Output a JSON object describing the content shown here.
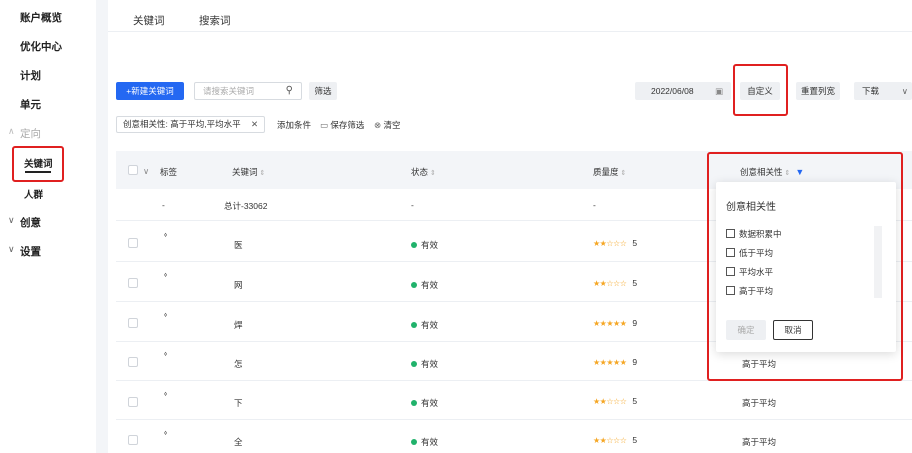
{
  "sidebar": {
    "items": [
      {
        "label": "账户概览"
      },
      {
        "label": "优化中心"
      },
      {
        "label": "计划"
      },
      {
        "label": "单元"
      },
      {
        "label": "定向"
      },
      {
        "label": "关键词"
      },
      {
        "label": "人群"
      },
      {
        "label": "创意"
      },
      {
        "label": "设置"
      }
    ]
  },
  "tabs": [
    {
      "label": "关键词"
    },
    {
      "label": "搜索词"
    }
  ],
  "toolbar": {
    "new_keyword": "+新建关键词",
    "search_placeholder": "请搜索关键词",
    "filter": "筛选",
    "date": "2022/06/08",
    "custom": "自定义",
    "reset_columns": "重置列宽",
    "download": "下载"
  },
  "filter_bar": {
    "chip": "创意相关性: 高于平均,平均水平",
    "add_condition": "添加条件",
    "save_filter": "保存筛选",
    "clear": "清空"
  },
  "table": {
    "columns": [
      "标签",
      "关键词",
      "状态",
      "质量度",
      "创意相关性"
    ],
    "total_row": {
      "tag": "-",
      "keyword": "总计-33062",
      "status": "-",
      "quality": "-"
    },
    "rows": [
      {
        "keyword": "医",
        "status": "有效",
        "stars": "★★☆☆☆",
        "quality": "5",
        "relevance": ""
      },
      {
        "keyword": "网",
        "status": "有效",
        "stars": "★★☆☆☆",
        "quality": "5",
        "relevance": ""
      },
      {
        "keyword": "焊",
        "status": "有效",
        "stars": "★★★★★",
        "quality": "9",
        "relevance": ""
      },
      {
        "keyword": "怎",
        "status": "有效",
        "stars": "★★★★★",
        "quality": "9",
        "relevance": "高于平均"
      },
      {
        "keyword": "下",
        "status": "有效",
        "stars": "★★☆☆☆",
        "quality": "5",
        "relevance": "高于平均"
      },
      {
        "keyword": "全",
        "status": "有效",
        "stars": "★★☆☆☆",
        "quality": "5",
        "relevance": "高于平均"
      }
    ]
  },
  "filter_popover": {
    "title": "创意相关性",
    "options": [
      "数据积累中",
      "低于平均",
      "平均水平",
      "高于平均"
    ],
    "confirm": "确定",
    "cancel": "取消"
  },
  "colors": {
    "primary": "#2468f2",
    "highlight": "#e02020",
    "status_ok": "#20b26b",
    "star": "#f5a623"
  }
}
